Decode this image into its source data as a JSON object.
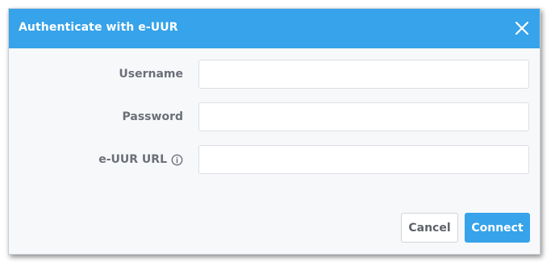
{
  "dialog": {
    "title": "Authenticate with e-UUR",
    "close_icon": "close-icon"
  },
  "form": {
    "username": {
      "label": "Username",
      "value": "",
      "placeholder": ""
    },
    "password": {
      "label": "Password",
      "value": "",
      "placeholder": ""
    },
    "url": {
      "label": "e-UUR URL",
      "value": "",
      "placeholder": "",
      "info_icon": "info-icon"
    }
  },
  "buttons": {
    "cancel_label": "Cancel",
    "connect_label": "Connect"
  },
  "colors": {
    "accent": "#36a3ea",
    "label": "#6b6f78",
    "background": "#f7f8fa"
  }
}
